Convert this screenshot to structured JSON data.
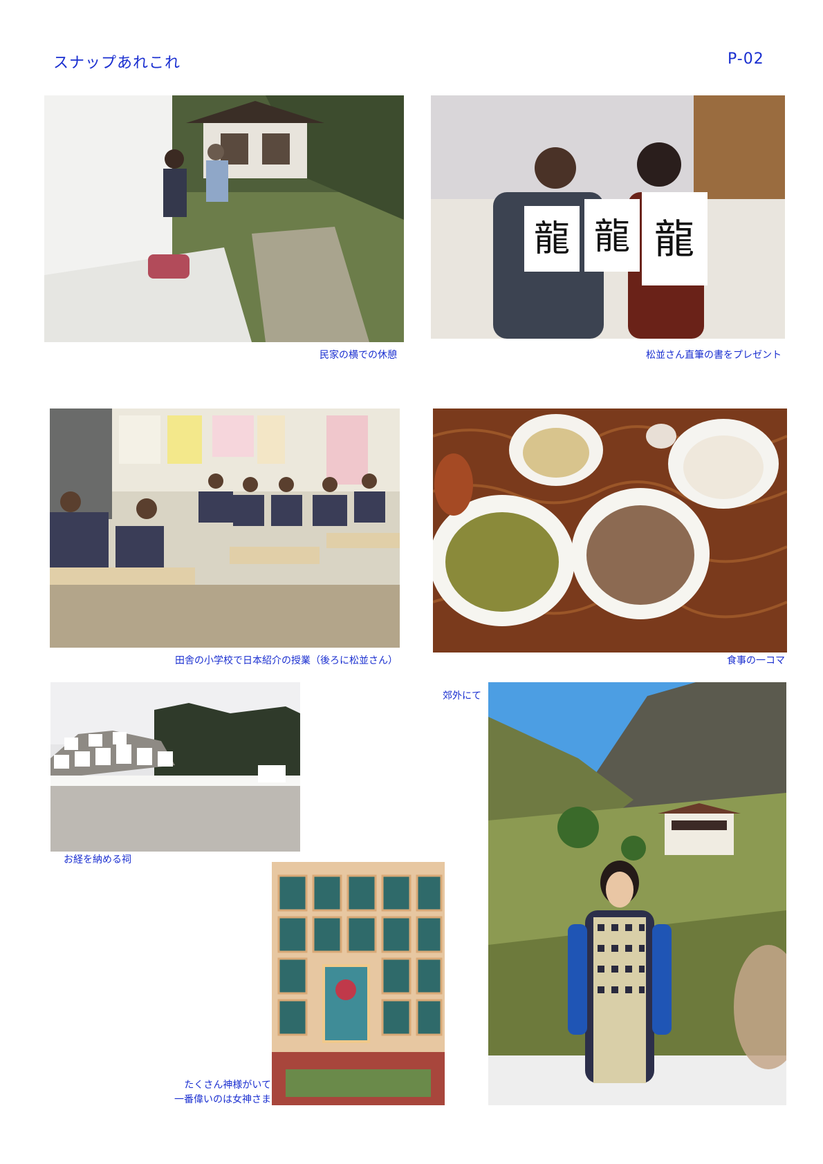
{
  "header": {
    "title": "スナップあれこれ",
    "page_number": "P-02"
  },
  "photos": [
    {
      "caption": "民家の横での休憩"
    },
    {
      "caption": "松並さん直筆の書をプレゼント",
      "calligraphy": [
        "龍",
        "龍",
        "龍"
      ]
    },
    {
      "caption": "田舎の小学校で日本紹介の授業（後ろに松並さん）"
    },
    {
      "caption": "食事の一コマ"
    },
    {
      "caption": "お経を納める祠"
    },
    {
      "caption_lines": [
        "たくさん神様がいて",
        "一番偉いのは女神さま"
      ]
    },
    {
      "caption": "郊外にて"
    }
  ],
  "colors": {
    "accent": "#1a2fd0"
  }
}
